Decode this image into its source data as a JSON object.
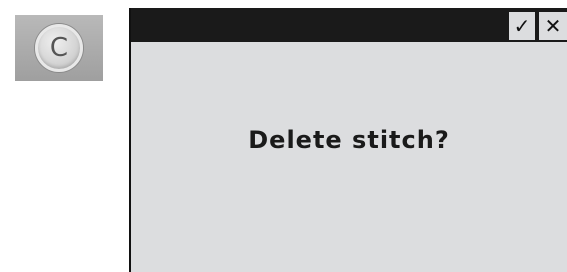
{
  "clear_button": {
    "label": "C"
  },
  "dialog": {
    "message": "Delete stitch?",
    "confirm_icon": "✓",
    "close_icon": "✕"
  }
}
